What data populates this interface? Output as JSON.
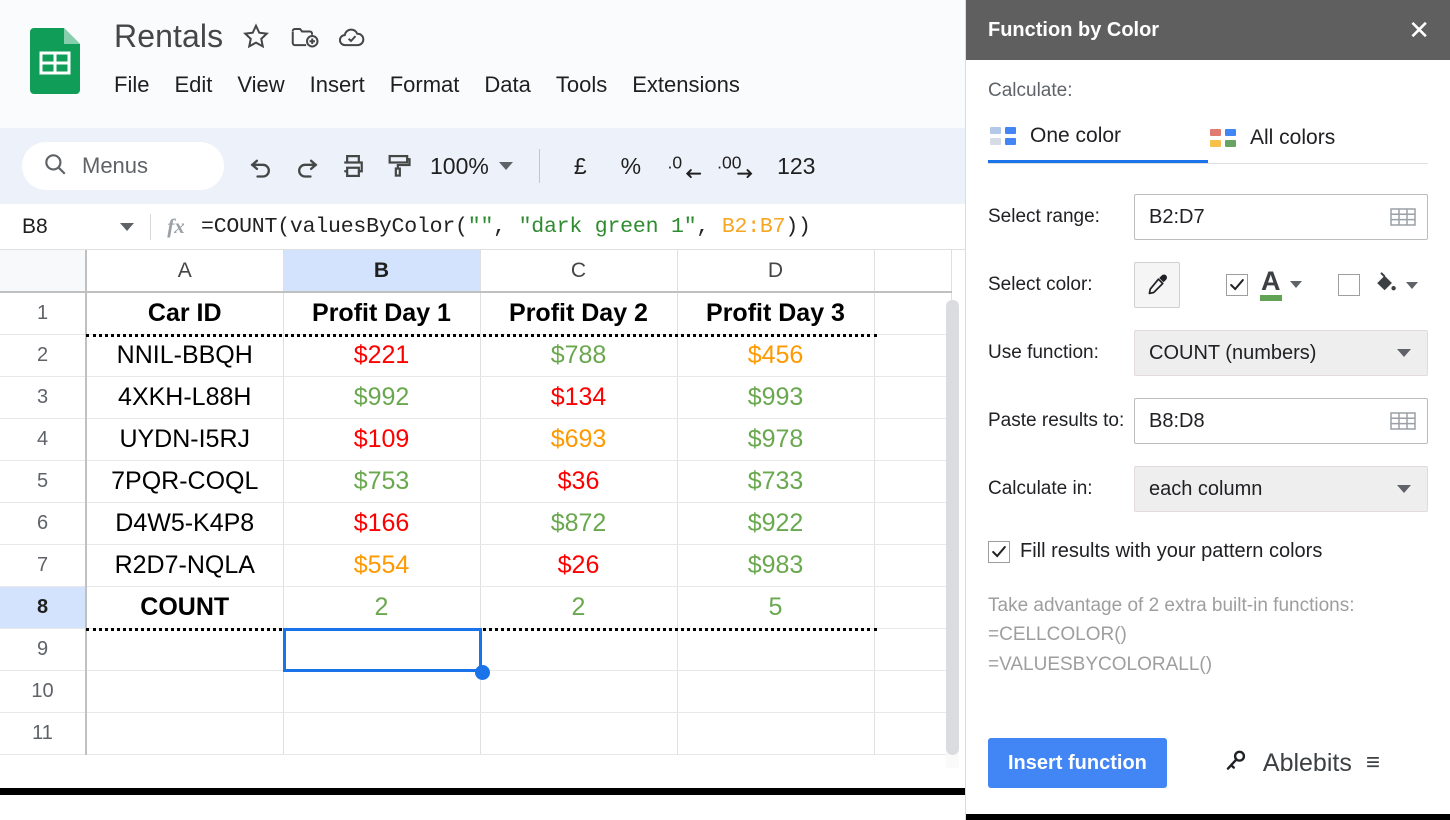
{
  "sheets": {
    "doc_title": "Rentals",
    "title_icons": [
      "star-icon",
      "move-to-folder-icon",
      "saved-to-drive-icon"
    ],
    "menu_items": [
      "File",
      "Edit",
      "View",
      "Insert",
      "Format",
      "Data",
      "Tools",
      "Extensions"
    ],
    "toolbar": {
      "search_label": "Menus",
      "undo_icon": "undo-icon",
      "redo_icon": "redo-icon",
      "print_icon": "print-icon",
      "paint_format_icon": "paint-format-icon",
      "zoom_value": "100%",
      "currency_label": "£",
      "percent_label": "%",
      "decrease_decimal_label": ".0",
      "increase_decimal_label": ".00",
      "number_format_label": "123"
    },
    "formula_bar": {
      "name_box": "B8",
      "fx_label": "fx",
      "formula_parts": [
        {
          "text": "=COUNT(valuesByColor(",
          "kind": "plain"
        },
        {
          "text": "\"\"",
          "kind": "string"
        },
        {
          "text": ", ",
          "kind": "plain"
        },
        {
          "text": "\"dark green 1\"",
          "kind": "string"
        },
        {
          "text": ", ",
          "kind": "plain"
        },
        {
          "text": "B2:B7",
          "kind": "ref"
        },
        {
          "text": "))",
          "kind": "plain"
        }
      ],
      "formula_full": "=COUNT(valuesByColor(\"\", \"dark green 1\", B2:B7))"
    },
    "grid": {
      "column_headers": [
        "A",
        "B",
        "C",
        "D",
        ""
      ],
      "selected_column": "B",
      "selected_row": "8",
      "row_numbers": [
        "1",
        "2",
        "3",
        "4",
        "5",
        "6",
        "7",
        "8",
        "9",
        "10",
        "11"
      ],
      "rows": [
        {
          "num": "1",
          "cells": [
            {
              "v": "Car ID",
              "color": "black",
              "bold": true
            },
            {
              "v": "Profit Day 1",
              "color": "black",
              "bold": true
            },
            {
              "v": "Profit Day 2",
              "color": "black",
              "bold": true
            },
            {
              "v": "Profit Day 3",
              "color": "black",
              "bold": true
            },
            {
              "v": "",
              "color": "black",
              "bold": false
            }
          ]
        },
        {
          "num": "2",
          "cells": [
            {
              "v": "NNIL-BBQH",
              "color": "black",
              "bold": false
            },
            {
              "v": "$221",
              "color": "red",
              "bold": false
            },
            {
              "v": "$788",
              "color": "green",
              "bold": false
            },
            {
              "v": "$456",
              "color": "orange",
              "bold": false
            },
            {
              "v": "",
              "color": "black",
              "bold": false
            }
          ]
        },
        {
          "num": "3",
          "cells": [
            {
              "v": "4XKH-L88H",
              "color": "black",
              "bold": false
            },
            {
              "v": "$992",
              "color": "green",
              "bold": false
            },
            {
              "v": "$134",
              "color": "red",
              "bold": false
            },
            {
              "v": "$993",
              "color": "green",
              "bold": false
            },
            {
              "v": "",
              "color": "black",
              "bold": false
            }
          ]
        },
        {
          "num": "4",
          "cells": [
            {
              "v": "UYDN-I5RJ",
              "color": "black",
              "bold": false
            },
            {
              "v": "$109",
              "color": "red",
              "bold": false
            },
            {
              "v": "$693",
              "color": "orange",
              "bold": false
            },
            {
              "v": "$978",
              "color": "green",
              "bold": false
            },
            {
              "v": "",
              "color": "black",
              "bold": false
            }
          ]
        },
        {
          "num": "5",
          "cells": [
            {
              "v": "7PQR-COQL",
              "color": "black",
              "bold": false
            },
            {
              "v": "$753",
              "color": "green",
              "bold": false
            },
            {
              "v": "$36",
              "color": "red",
              "bold": false
            },
            {
              "v": "$733",
              "color": "green",
              "bold": false
            },
            {
              "v": "",
              "color": "black",
              "bold": false
            }
          ]
        },
        {
          "num": "6",
          "cells": [
            {
              "v": "D4W5-K4P8",
              "color": "black",
              "bold": false
            },
            {
              "v": "$166",
              "color": "red",
              "bold": false
            },
            {
              "v": "$872",
              "color": "green",
              "bold": false
            },
            {
              "v": "$922",
              "color": "green",
              "bold": false
            },
            {
              "v": "",
              "color": "black",
              "bold": false
            }
          ]
        },
        {
          "num": "7",
          "cells": [
            {
              "v": "R2D7-NQLA",
              "color": "black",
              "bold": false
            },
            {
              "v": "$554",
              "color": "orange",
              "bold": false
            },
            {
              "v": "$26",
              "color": "red",
              "bold": false
            },
            {
              "v": "$983",
              "color": "green",
              "bold": false
            },
            {
              "v": "",
              "color": "black",
              "bold": false
            }
          ]
        },
        {
          "num": "8",
          "cells": [
            {
              "v": "COUNT",
              "color": "black",
              "bold": true
            },
            {
              "v": "2",
              "color": "green",
              "bold": false
            },
            {
              "v": "2",
              "color": "green",
              "bold": false
            },
            {
              "v": "5",
              "color": "green",
              "bold": false
            },
            {
              "v": "",
              "color": "black",
              "bold": false
            }
          ]
        },
        {
          "num": "9",
          "cells": [
            {
              "v": "",
              "color": "black",
              "bold": false
            },
            {
              "v": "",
              "color": "black",
              "bold": false
            },
            {
              "v": "",
              "color": "black",
              "bold": false
            },
            {
              "v": "",
              "color": "black",
              "bold": false
            },
            {
              "v": "",
              "color": "black",
              "bold": false
            }
          ]
        },
        {
          "num": "10",
          "cells": [
            {
              "v": "",
              "color": "black",
              "bold": false
            },
            {
              "v": "",
              "color": "black",
              "bold": false
            },
            {
              "v": "",
              "color": "black",
              "bold": false
            },
            {
              "v": "",
              "color": "black",
              "bold": false
            },
            {
              "v": "",
              "color": "black",
              "bold": false
            }
          ]
        },
        {
          "num": "11",
          "cells": [
            {
              "v": "",
              "color": "black",
              "bold": false
            },
            {
              "v": "",
              "color": "black",
              "bold": false
            },
            {
              "v": "",
              "color": "black",
              "bold": false
            },
            {
              "v": "",
              "color": "black",
              "bold": false
            },
            {
              "v": "",
              "color": "black",
              "bold": false
            }
          ]
        }
      ]
    }
  },
  "panel": {
    "title": "Function by Color",
    "close_label": "✕",
    "calculate_label": "Calculate:",
    "tabs": [
      {
        "label": "One color",
        "active": true,
        "swatches": [
          "#b4c8ea",
          "#4285f4",
          "#d6dce6",
          "#4285f4"
        ]
      },
      {
        "label": "All colors",
        "active": false,
        "swatches": [
          "#e07b72",
          "#4285f4",
          "#f7c04a",
          "#67a464"
        ]
      }
    ],
    "fields": {
      "select_range_label": "Select range:",
      "select_range_value": "B2:D7",
      "select_color_label": "Select color:",
      "use_function_label": "Use function:",
      "use_function_value": "COUNT (numbers)",
      "paste_results_label": "Paste results to:",
      "paste_results_value": "B8:D8",
      "calculate_in_label": "Calculate in:",
      "calculate_in_value": "each column"
    },
    "color_controls": {
      "eyedropper_icon": "eyedropper-icon",
      "font_color_checked": true,
      "font_color_glyph": "A",
      "font_color_swatch": "#63a355",
      "fill_color_checked": false,
      "fill_color_icon": "fill-bucket-icon"
    },
    "fill_results": {
      "checked": true,
      "label": "Fill results with your pattern colors"
    },
    "tips": {
      "line1": "Take advantage of 2 extra built-in functions:",
      "line2": "=CELLCOLOR()",
      "line3": "=VALUESBYCOLORALL()"
    },
    "footer": {
      "insert_button": "Insert function",
      "brand_name": "Ablebits",
      "brand_icon": "key-icon",
      "menu_icon": "hamburger-icon"
    },
    "accent_color": "#1a73e8"
  }
}
